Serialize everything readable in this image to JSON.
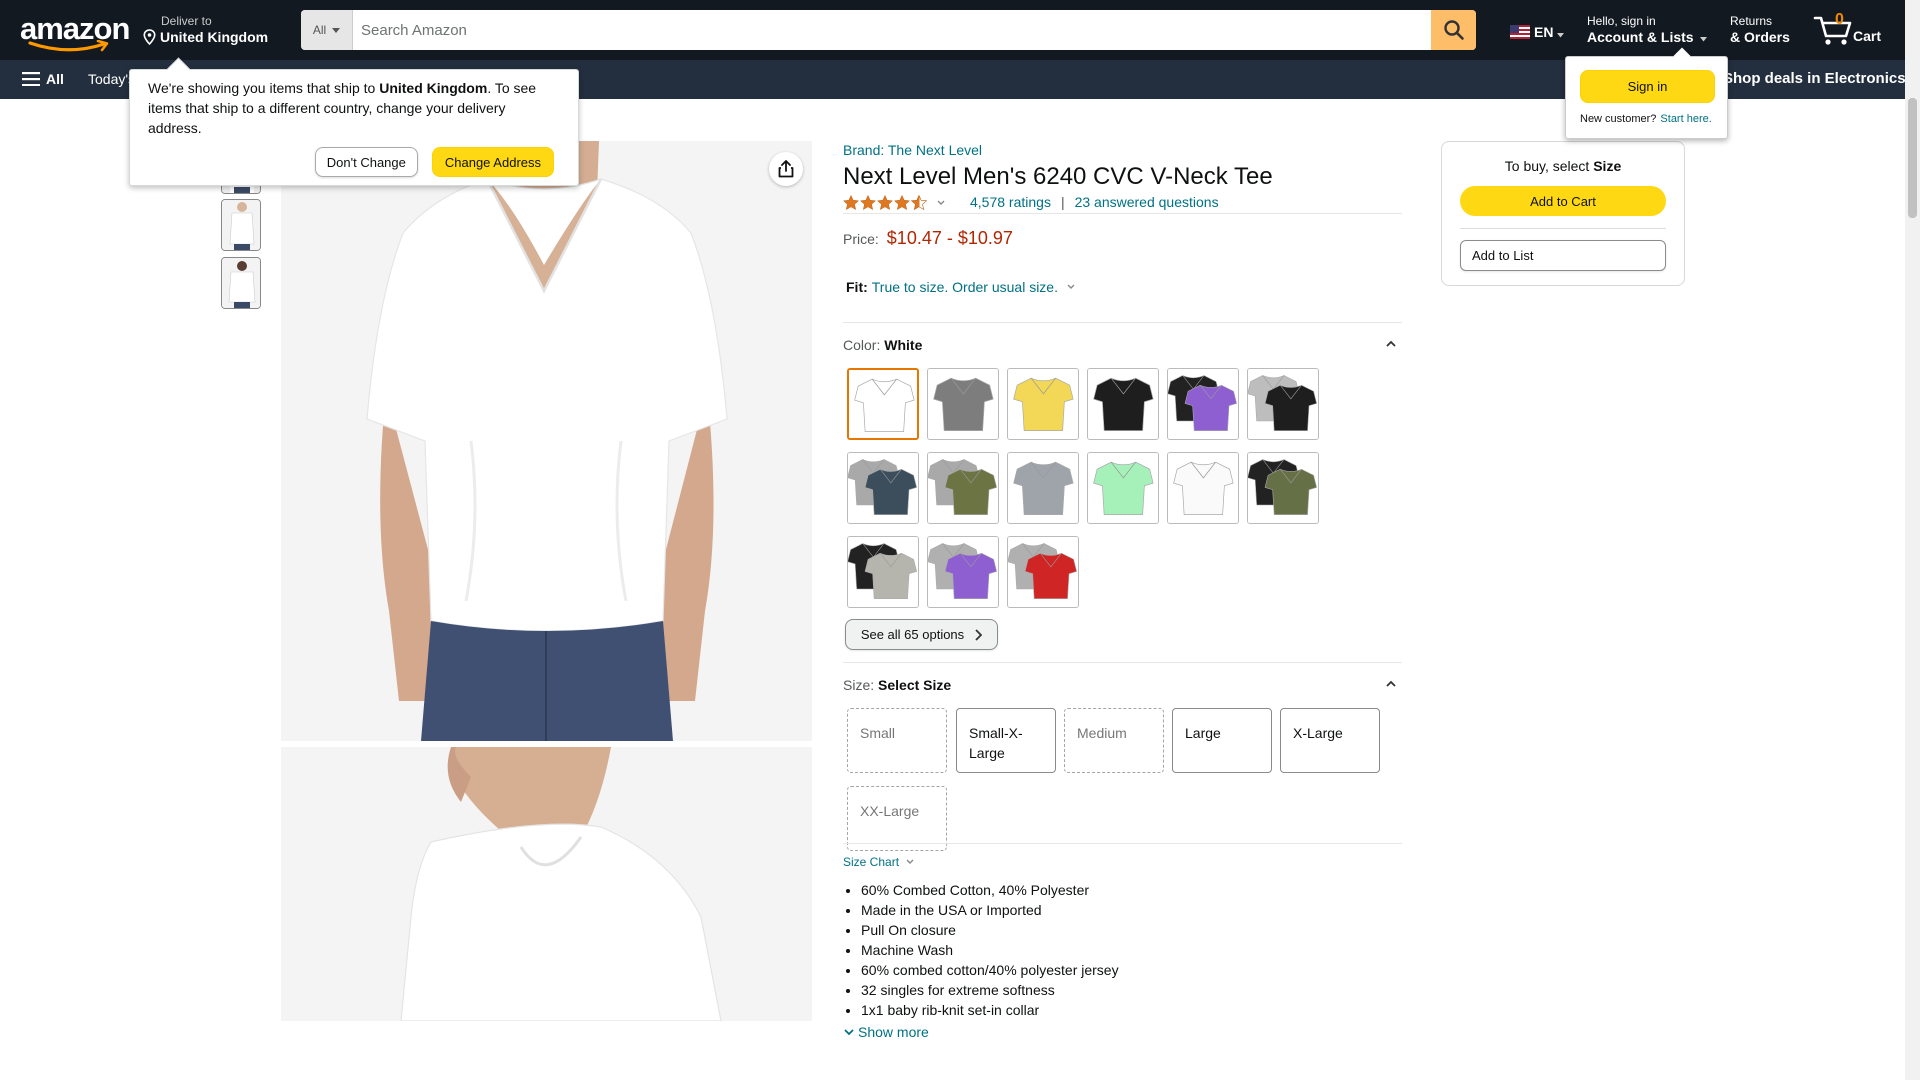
{
  "header": {
    "logo": "amazon",
    "deliver_line1": "Deliver to",
    "deliver_line2": "United Kingdom",
    "search_category": "All",
    "search_placeholder": "Search Amazon",
    "lang": "EN",
    "account_line1": "Hello, sign in",
    "account_line2": "Account & Lists",
    "returns_line1": "Returns",
    "returns_line2": "& Orders",
    "cart_count": "0",
    "cart_label": "Cart"
  },
  "subnav": {
    "all": "All",
    "today": "Today's Deals",
    "promo": "Shop deals in Electronics"
  },
  "address_popover": {
    "text_before": "We're showing you items that ship to ",
    "country": "United Kingdom",
    "text_after": ". To see items that ship to a different country, change your delivery address.",
    "dont_change": "Don't Change",
    "change_address": "Change Address"
  },
  "signin_popover": {
    "button": "Sign in",
    "new_customer": "New customer?",
    "start_here": "Start here."
  },
  "product": {
    "brand": "Brand: The Next Level",
    "title": "Next Level Men's 6240 CVC V-Neck Tee",
    "rating": 4.5,
    "ratings_count": "4,578 ratings",
    "answered": "23 answered questions",
    "price_label": "Price:",
    "price": "$10.47 - $10.97",
    "fit_label": "Fit:",
    "fit_value": "True to size. Order usual size.",
    "color_label": "Color:",
    "color_value": "White",
    "size_label": "Size:",
    "size_value": "Select Size",
    "see_all": "See all 65 options",
    "size_chart": "Size Chart",
    "show_more": "Show more"
  },
  "swatches": [
    {
      "colors": [
        "#ffffff"
      ],
      "selected": true
    },
    {
      "colors": [
        "#7d7d7d"
      ]
    },
    {
      "colors": [
        "#f2d856"
      ]
    },
    {
      "colors": [
        "#1e1e1e"
      ]
    },
    {
      "colors": [
        "#222222",
        "#8e5fd0"
      ]
    },
    {
      "colors": [
        "#bdbdbd",
        "#1e1e1e"
      ]
    },
    {
      "colors": [
        "#a9a9a9",
        "#3c4d5c"
      ]
    },
    {
      "colors": [
        "#a9a9a9",
        "#6d7443"
      ]
    },
    {
      "colors": [
        "#9fa4ab"
      ]
    },
    {
      "colors": [
        "#a6f0b9"
      ]
    },
    {
      "colors": [
        "#fafafa"
      ]
    },
    {
      "colors": [
        "#222222",
        "#667046"
      ]
    },
    {
      "colors": [
        "#222222",
        "#b5b5ad"
      ]
    },
    {
      "colors": [
        "#b0b0b0",
        "#8e5fd0"
      ]
    },
    {
      "colors": [
        "#b0b0b0",
        "#cf2525"
      ]
    }
  ],
  "sizes": [
    {
      "label": "Small",
      "available": false
    },
    {
      "label": "Small-X-Large",
      "available": true
    },
    {
      "label": "Medium",
      "available": false
    },
    {
      "label": "Large",
      "available": true
    },
    {
      "label": "X-Large",
      "available": true
    },
    {
      "label": "XX-Large",
      "available": false
    }
  ],
  "bullets": [
    "60% Combed Cotton, 40% Polyester",
    "Made in the USA or Imported",
    "Pull On closure",
    "Machine Wash",
    "60% combed cotton/40% polyester jersey",
    "32 singles for extreme softness",
    "1x1 baby rib-knit set-in collar"
  ],
  "buybox": {
    "prompt": "To buy, select ",
    "prompt_bold": "Size",
    "add_to_cart": "Add to Cart",
    "add_to_list": "Add to List"
  },
  "colors": {
    "nav_dark": "#131921",
    "nav_sub": "#232f3e",
    "accent_yellow": "#ffd814",
    "search_button": "#febd69",
    "link": "#007185",
    "price": "#b12704",
    "star": "#de7921"
  },
  "icons": [
    "location-pin-icon",
    "search-icon",
    "cart-icon",
    "hamburger-icon",
    "share-icon",
    "star-icon",
    "chevron-down-icon",
    "chevron-up-icon",
    "chevron-right-icon"
  ]
}
